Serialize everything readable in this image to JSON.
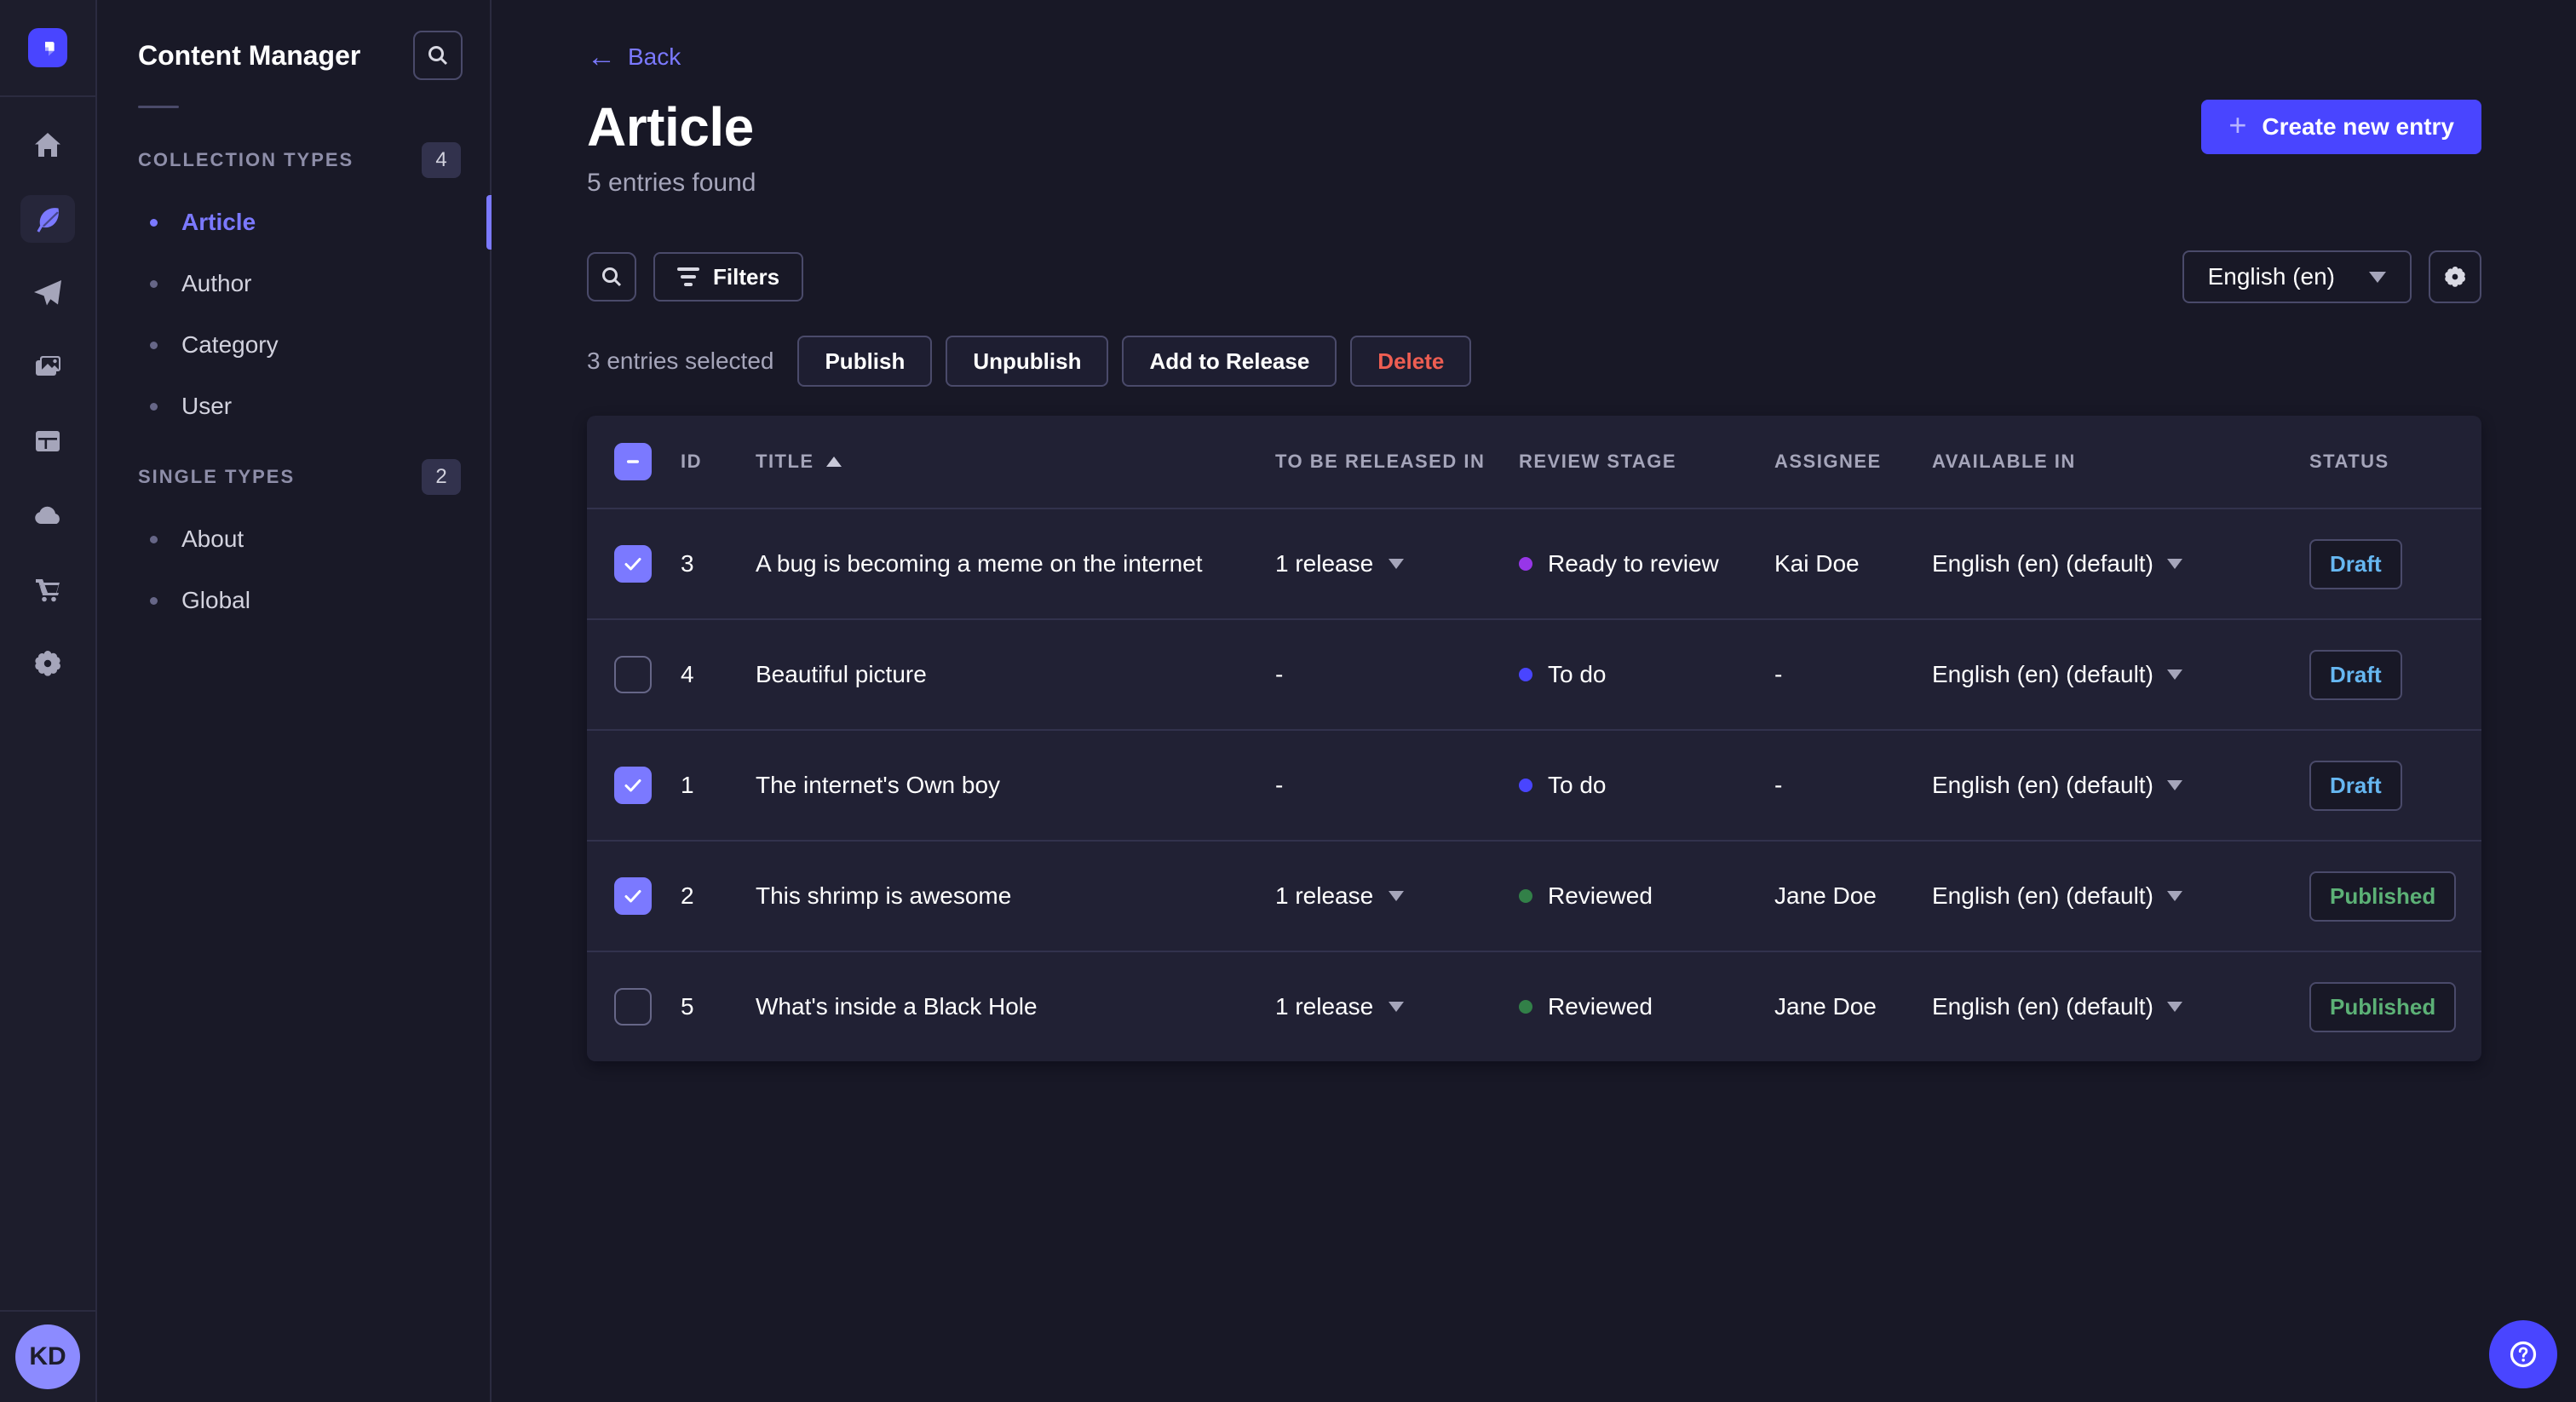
{
  "nav": {
    "logo": "strapi-logo",
    "items": [
      {
        "name": "home"
      },
      {
        "name": "content-manager",
        "active": true
      },
      {
        "name": "releases"
      },
      {
        "name": "media-library"
      },
      {
        "name": "content-type-builder"
      },
      {
        "name": "deploy"
      },
      {
        "name": "marketplace"
      },
      {
        "name": "settings"
      }
    ],
    "avatar_initials": "KD"
  },
  "subnav": {
    "title": "Content Manager",
    "sections": [
      {
        "label": "COLLECTION TYPES",
        "count": "4",
        "items": [
          {
            "label": "Article",
            "active": true
          },
          {
            "label": "Author"
          },
          {
            "label": "Category"
          },
          {
            "label": "User"
          }
        ]
      },
      {
        "label": "SINGLE TYPES",
        "count": "2",
        "items": [
          {
            "label": "About"
          },
          {
            "label": "Global"
          }
        ]
      }
    ]
  },
  "header": {
    "back_label": "Back",
    "title": "Article",
    "subtitle": "5 entries found",
    "create_button_label": "Create new entry"
  },
  "toolbar": {
    "filters_label": "Filters",
    "locale_selected": "English (en)"
  },
  "selection": {
    "text": "3 entries selected",
    "publish_label": "Publish",
    "unpublish_label": "Unpublish",
    "add_to_release_label": "Add to Release",
    "delete_label": "Delete"
  },
  "table": {
    "columns": [
      "ID",
      "TITLE",
      "TO BE RELEASED IN",
      "REVIEW STAGE",
      "ASSIGNEE",
      "AVAILABLE IN",
      "STATUS"
    ],
    "sorted_column": "TITLE",
    "sort_direction": "asc",
    "rows": [
      {
        "checked": true,
        "id": "3",
        "title": "A bug is becoming a meme on the internet",
        "release": "1 release",
        "stage": "Ready to review",
        "stage_color": "#9736e8",
        "assignee": "Kai Doe",
        "locale": "English (en) (default)",
        "status": "Draft",
        "status_variant": "draft"
      },
      {
        "checked": false,
        "id": "4",
        "title": "Beautiful picture",
        "release": "-",
        "stage": "To do",
        "stage_color": "#4945ff",
        "assignee": "-",
        "locale": "English (en) (default)",
        "status": "Draft",
        "status_variant": "draft"
      },
      {
        "checked": true,
        "id": "1",
        "title": "The internet's Own boy",
        "release": "-",
        "stage": "To do",
        "stage_color": "#4945ff",
        "assignee": "-",
        "locale": "English (en) (default)",
        "status": "Draft",
        "status_variant": "draft"
      },
      {
        "checked": true,
        "id": "2",
        "title": "This shrimp is awesome",
        "release": "1 release",
        "stage": "Reviewed",
        "stage_color": "#328048",
        "assignee": "Jane Doe",
        "locale": "English (en) (default)",
        "status": "Published",
        "status_variant": "published"
      },
      {
        "checked": false,
        "id": "5",
        "title": "What's inside a Black Hole",
        "release": "1 release",
        "stage": "Reviewed",
        "stage_color": "#328048",
        "assignee": "Jane Doe",
        "locale": "English (en) (default)",
        "status": "Published",
        "status_variant": "published"
      }
    ]
  },
  "colors": {
    "primary": "#4945ff",
    "primary_light": "#7b79ff",
    "danger": "#ee5e52",
    "draft_text": "#66b7f1",
    "published_text": "#5cb176",
    "stage_to_do": "#4945ff",
    "stage_ready_to_review": "#9736e8",
    "stage_reviewed": "#328048",
    "panel_bg": "#212134",
    "app_bg": "#181826"
  }
}
